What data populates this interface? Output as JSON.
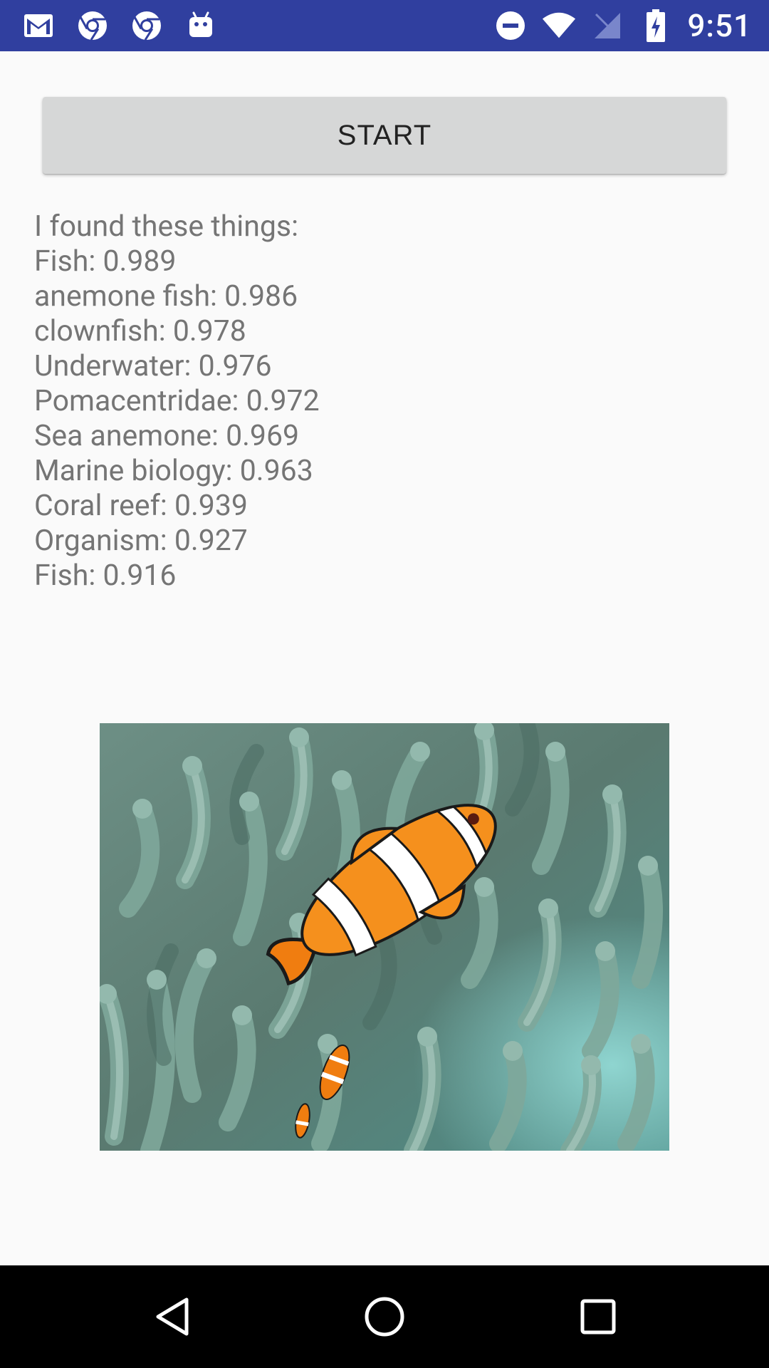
{
  "status_bar": {
    "time": "9:51",
    "left_icons": [
      "gmail-icon",
      "chrome-icon",
      "chrome-icon",
      "android-icon"
    ],
    "right_icons": [
      "do-not-disturb-icon",
      "wifi-icon",
      "no-signal-icon",
      "battery-charging-icon"
    ],
    "background": "#303f9f"
  },
  "main": {
    "start_label": "START",
    "results_heading": "I found these things:",
    "results": [
      "Fish: 0.989",
      "anemone fish: 0.986",
      "clownfish: 0.978",
      "Underwater: 0.976",
      "Pomacentridae: 0.972",
      "Sea anemone: 0.969",
      "Marine biology: 0.963",
      "Coral reef: 0.939",
      "Organism: 0.927",
      "Fish: 0.916"
    ],
    "photo_subject": "clownfish-in-anemone"
  },
  "nav_bar": {
    "icons": [
      "back-icon",
      "home-icon",
      "recents-icon"
    ]
  }
}
